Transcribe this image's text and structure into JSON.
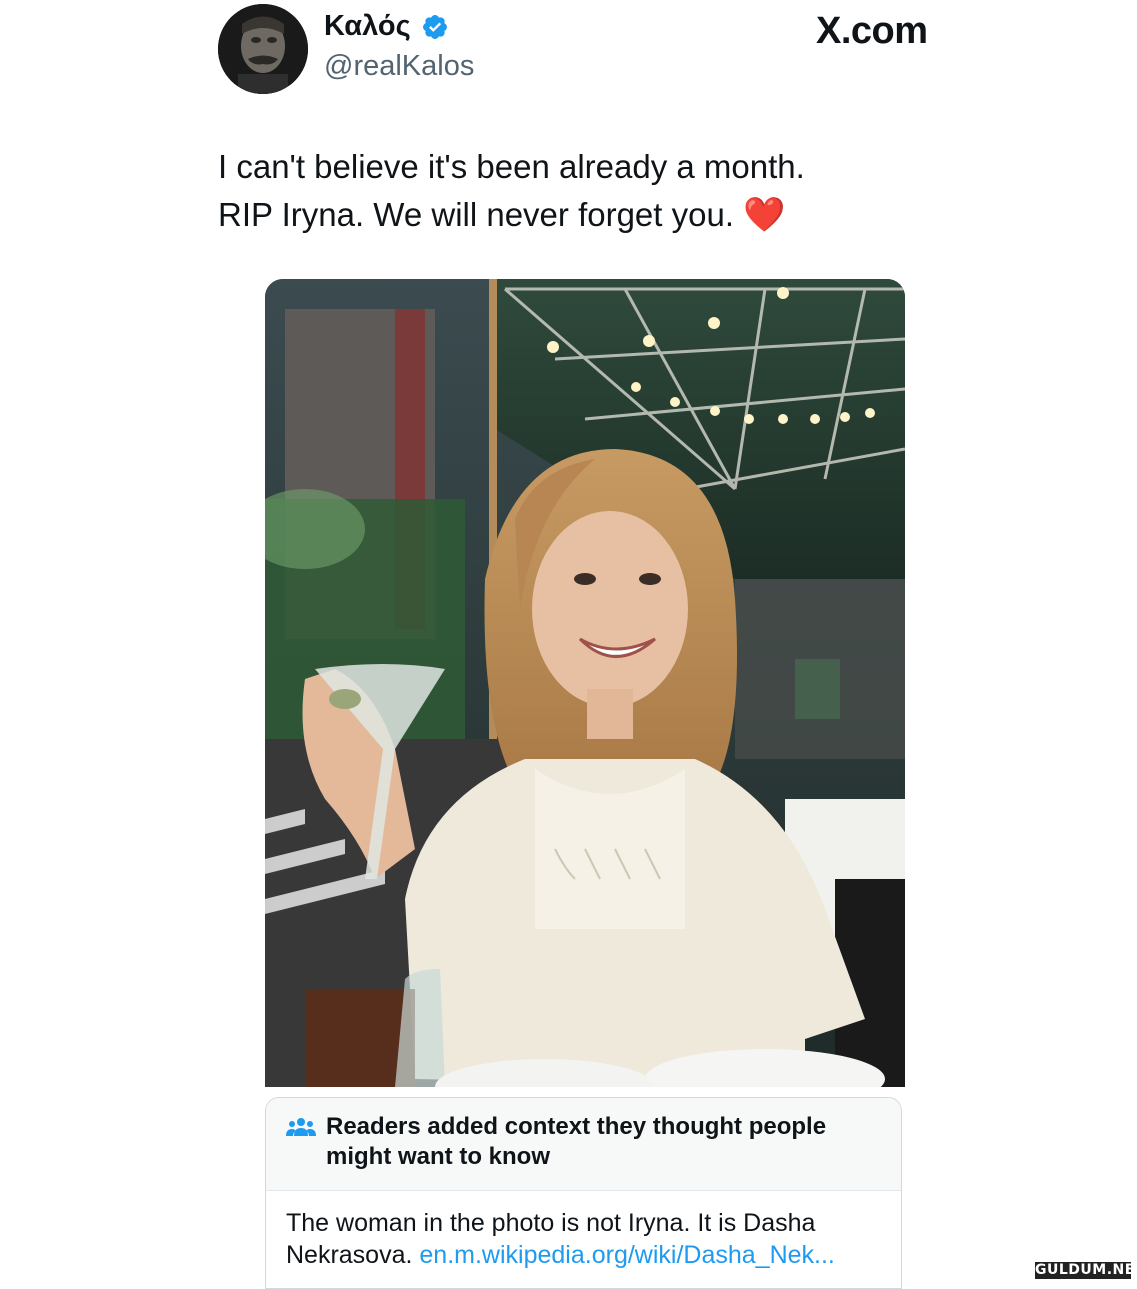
{
  "author": {
    "display_name": "Καλός",
    "handle": "@realKalos",
    "verified": true,
    "verified_color": "#1d9bf0"
  },
  "site_label": "X.com",
  "tweet": {
    "line1": "I can't believe it's been already a month.",
    "line2": "RIP Iryna. We will never forget you.",
    "emoji": "❤️"
  },
  "community_note": {
    "icon": "people-icon",
    "title": "Readers added context they thought people might want to know",
    "body": "The woman in the photo is not Iryna. It is Dasha Nekrasova.",
    "link_text": "en.m.wikipedia.org/wiki/Dasha_Nek..."
  },
  "watermark": "GULDUM.NET",
  "colors": {
    "text": "#0f1419",
    "secondary": "#536471",
    "link": "#1d9bf0",
    "heart": "#e0101f"
  }
}
